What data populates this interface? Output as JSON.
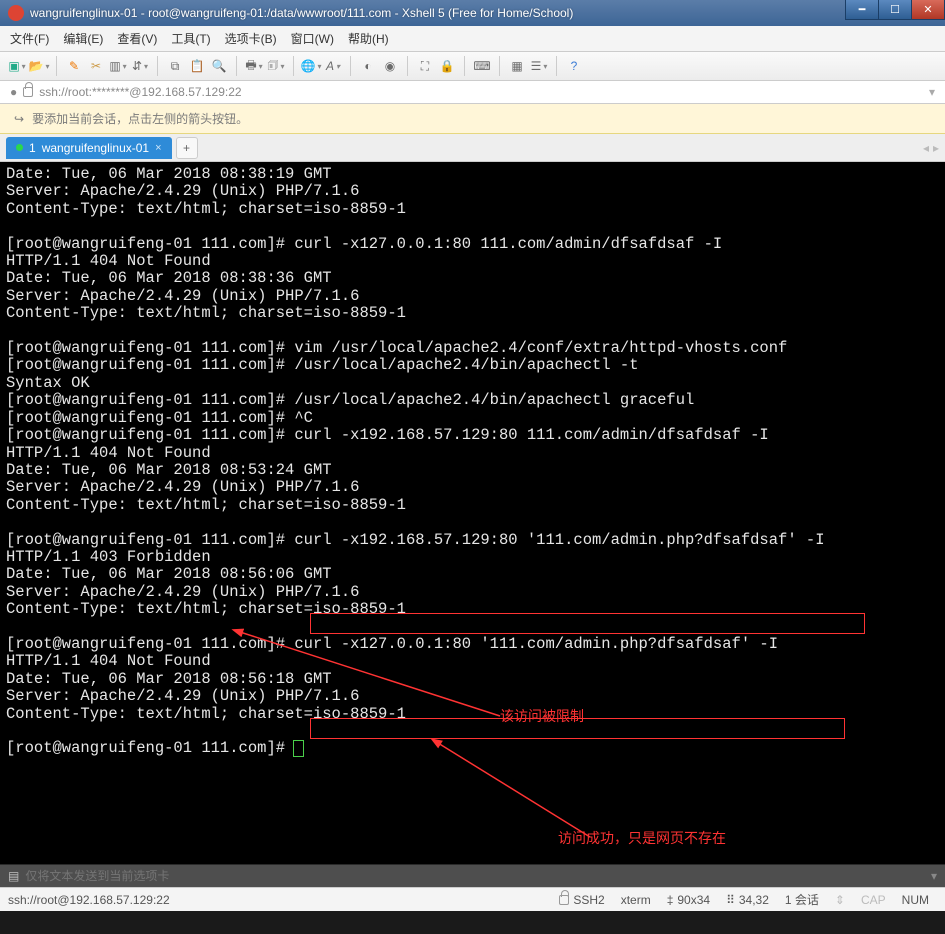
{
  "window": {
    "title": "wangruifenglinux-01 - root@wangruifeng-01:/data/wwwroot/111.com - Xshell 5 (Free for Home/School)"
  },
  "menu": {
    "file": "文件(F)",
    "edit": "编辑(E)",
    "view": "查看(V)",
    "tools": "工具(T)",
    "tabs": "选项卡(B)",
    "window": "窗口(W)",
    "help": "帮助(H)"
  },
  "address": {
    "url": "ssh://root:********@192.168.57.129:22"
  },
  "tip": {
    "text": "要添加当前会话，点击左侧的箭头按钮。"
  },
  "tab": {
    "index": "1",
    "name": "wangruifenglinux-01"
  },
  "terminal_lines": [
    "Date: Tue, 06 Mar 2018 08:38:19 GMT",
    "Server: Apache/2.4.29 (Unix) PHP/7.1.6",
    "Content-Type: text/html; charset=iso-8859-1",
    "",
    "[root@wangruifeng-01 111.com]# curl -x127.0.0.1:80 111.com/admin/dfsafdsaf -I",
    "HTTP/1.1 404 Not Found",
    "Date: Tue, 06 Mar 2018 08:38:36 GMT",
    "Server: Apache/2.4.29 (Unix) PHP/7.1.6",
    "Content-Type: text/html; charset=iso-8859-1",
    "",
    "[root@wangruifeng-01 111.com]# vim /usr/local/apache2.4/conf/extra/httpd-vhosts.conf",
    "[root@wangruifeng-01 111.com]# /usr/local/apache2.4/bin/apachectl -t",
    "Syntax OK",
    "[root@wangruifeng-01 111.com]# /usr/local/apache2.4/bin/apachectl graceful",
    "[root@wangruifeng-01 111.com]# ^C",
    "[root@wangruifeng-01 111.com]# curl -x192.168.57.129:80 111.com/admin/dfsafdsaf -I",
    "HTTP/1.1 404 Not Found",
    "Date: Tue, 06 Mar 2018 08:53:24 GMT",
    "Server: Apache/2.4.29 (Unix) PHP/7.1.6",
    "Content-Type: text/html; charset=iso-8859-1",
    "",
    "[root@wangruifeng-01 111.com]# curl -x192.168.57.129:80 '111.com/admin.php?dfsafdsaf' -I",
    "HTTP/1.1 403 Forbidden",
    "Date: Tue, 06 Mar 2018 08:56:06 GMT",
    "Server: Apache/2.4.29 (Unix) PHP/7.1.6",
    "Content-Type: text/html; charset=iso-8859-1",
    "",
    "[root@wangruifeng-01 111.com]# curl -x127.0.0.1:80 '111.com/admin.php?dfsafdsaf' -I",
    "HTTP/1.1 404 Not Found",
    "Date: Tue, 06 Mar 2018 08:56:18 GMT",
    "Server: Apache/2.4.29 (Unix) PHP/7.1.6",
    "Content-Type: text/html; charset=iso-8859-1",
    "",
    "[root@wangruifeng-01 111.com]# "
  ],
  "annotations": {
    "note1": "该访问被限制",
    "note2": "访问成功，只是网页不存在"
  },
  "bottom_input": {
    "placeholder": "仅将文本发送到当前选项卡"
  },
  "status": {
    "conn": "ssh://root@192.168.57.129:22",
    "proto": "SSH2",
    "term": "xterm",
    "size": "90x34",
    "pos": "34,32",
    "sess": "1 会话",
    "cap": "CAP",
    "num": "NUM"
  }
}
